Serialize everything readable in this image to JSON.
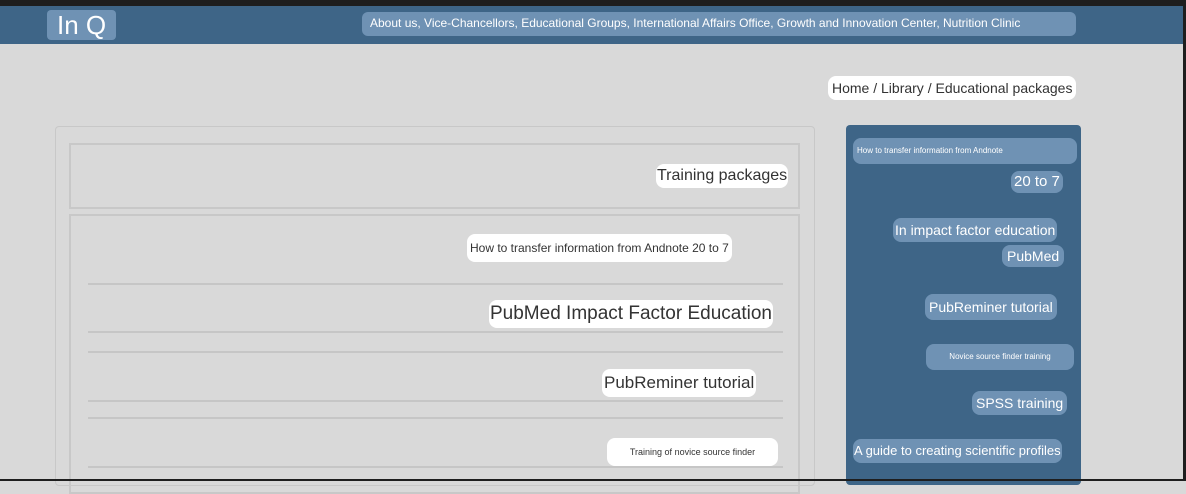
{
  "header": {
    "logo": "In Q",
    "nav": "About us, Vice-Chancellors, Educational Groups, International Affairs Office, Growth and Innovation Center, Nutrition Clinic"
  },
  "breadcrumb": "Home / Library / Educational packages",
  "main": {
    "section_title": "Training packages",
    "items": [
      "How to transfer information from Andnote 20 to 7",
      "PubMed Impact Factor Education",
      "PubReminer tutorial",
      "Training of novice source finder"
    ]
  },
  "sidebar": {
    "items": [
      "How to transfer information from Andnote",
      "20 to 7",
      "In impact factor education",
      "PubMed",
      "PubReminer tutorial",
      "Novice source finder training",
      "SPSS training",
      "A guide to creating scientific profiles"
    ]
  },
  "colors": {
    "header_bg": "#3e6587",
    "accent": "#6f92b4",
    "page_bg": "#d9d9d9"
  }
}
